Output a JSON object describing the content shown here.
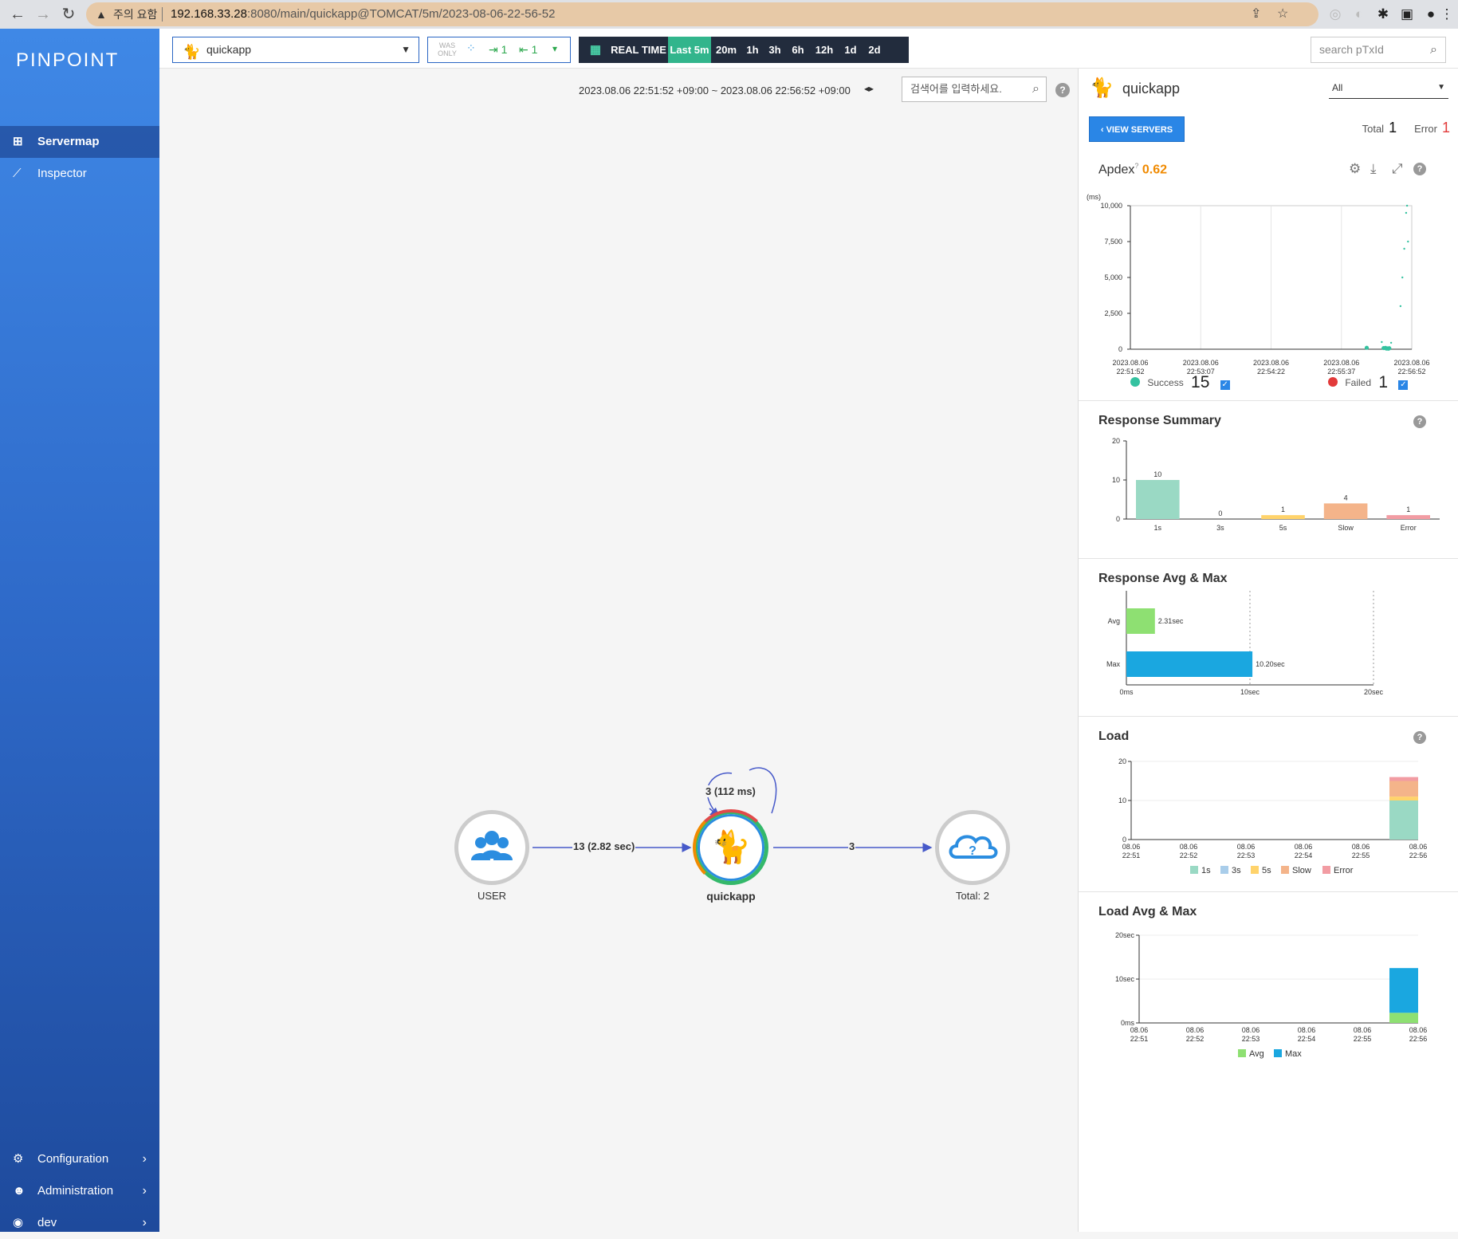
{
  "browser": {
    "warning_text": "주의 요함",
    "url_host": "192.168.33.28",
    "url_rest": ":8080/main/quickapp@TOMCAT/5m/2023-08-06-22-56-52"
  },
  "sidebar": {
    "logo": "PINPOINT",
    "items": [
      {
        "label": "Servermap",
        "icon": "servermap-icon"
      },
      {
        "label": "Inspector",
        "icon": "chart-icon"
      }
    ],
    "bottom_items": [
      {
        "label": "Configuration",
        "icon": "gear-icon"
      },
      {
        "label": "Administration",
        "icon": "user-cog-icon"
      },
      {
        "label": "dev",
        "icon": "user-circle-icon"
      }
    ]
  },
  "topbar": {
    "application": "quickapp",
    "was_only": "WAS ONLY",
    "inbound_count": "1",
    "outbound_count": "1",
    "real_time": "REAL TIME",
    "periods": [
      "Last 5m",
      "20m",
      "1h",
      "3h",
      "6h",
      "12h",
      "1d",
      "2d"
    ],
    "active_period": "Last 5m",
    "search_placeholder": "search pTxId"
  },
  "servermap": {
    "time_range": "2023.08.06 22:51:52 +09:00 ~ 2023.08.06 22:56:52 +09:00",
    "search_placeholder": "검색어를 입력하세요.",
    "nodes": {
      "user": "USER",
      "app": "quickapp",
      "unknown": "Total: 2"
    },
    "edges": {
      "user_to_app": "13 (2.82 sec)",
      "app_self": "3 (112 ms)",
      "app_to_unknown": "3"
    }
  },
  "panel": {
    "app_name": "quickapp",
    "agent_filter": "All",
    "view_servers": "VIEW SERVERS",
    "total_label": "Total",
    "total_value": "1",
    "error_label": "Error",
    "error_value": "1",
    "apdex_label": "Apdex",
    "apdex_score": "0.62",
    "success_label": "Success",
    "success_count": "15",
    "failed_label": "Failed",
    "failed_count": "1",
    "colors": {
      "success": "#34c2a0",
      "failed": "#e23a3a",
      "accent": "#2a86e6",
      "apdex": "#f08a00"
    }
  },
  "chart_data": [
    {
      "type": "scatter",
      "title": "Apdex",
      "ylabel": "(ms)",
      "ylim": [
        0,
        10000
      ],
      "yticks": [
        "10,000",
        "7,500",
        "5,000",
        "2,500",
        "0"
      ],
      "xticks": [
        "2023.08.06 22:51:52",
        "2023.08.06 22:53:07",
        "2023.08.06 22:54:22",
        "2023.08.06 22:55:37",
        "2023.08.06 22:56:52"
      ],
      "series": [
        {
          "name": "Success",
          "points": [
            [
              "22:56:04",
              100
            ],
            [
              "22:56:20",
              500
            ],
            [
              "22:56:22",
              80
            ],
            [
              "22:56:24",
              90
            ],
            [
              "22:56:26",
              60
            ],
            [
              "22:56:30",
              450
            ],
            [
              "22:56:40",
              3000
            ],
            [
              "22:56:42",
              5000
            ],
            [
              "22:56:44",
              7000
            ],
            [
              "22:56:46",
              9500
            ],
            [
              "22:56:47",
              10000
            ],
            [
              "22:56:48",
              7500
            ],
            [
              "22:56:28",
              70
            ],
            [
              "22:56:25",
              50
            ],
            [
              "22:56:27",
              40
            ]
          ]
        },
        {
          "name": "Failed",
          "points": []
        }
      ]
    },
    {
      "type": "bar",
      "title": "Response Summary",
      "categories": [
        "1s",
        "3s",
        "5s",
        "Slow",
        "Error"
      ],
      "values": [
        10,
        0,
        1,
        4,
        1
      ],
      "ylim": [
        0,
        20
      ],
      "yticks": [
        "20",
        "10",
        "0"
      ],
      "colors": [
        "#9ad9c4",
        "#a9cdea",
        "#ffd36b",
        "#f4b48a",
        "#f29ca3"
      ]
    },
    {
      "type": "bar",
      "title": "Response Avg & Max",
      "categories": [
        "Avg",
        "Max"
      ],
      "values": [
        2.31,
        10.2
      ],
      "labels": [
        "2.31sec",
        "10.20sec"
      ],
      "xlim": [
        0,
        20
      ],
      "xticks": [
        "0ms",
        "10sec",
        "20sec"
      ],
      "colors": [
        "#8ee072",
        "#1aa7e0"
      ]
    },
    {
      "type": "bar",
      "title": "Load",
      "categories": [
        "08.06 22:51",
        "08.06 22:52",
        "08.06 22:53",
        "08.06 22:54",
        "08.06 22:55",
        "08.06 22:56"
      ],
      "ylim": [
        0,
        20
      ],
      "yticks": [
        "20",
        "10",
        "0"
      ],
      "series": [
        {
          "name": "1s",
          "values": [
            0,
            0,
            0,
            0,
            0,
            10
          ]
        },
        {
          "name": "3s",
          "values": [
            0,
            0,
            0,
            0,
            0,
            0
          ]
        },
        {
          "name": "5s",
          "values": [
            0,
            0,
            0,
            0,
            0,
            1
          ]
        },
        {
          "name": "Slow",
          "values": [
            0,
            0,
            0,
            0,
            0,
            4
          ]
        },
        {
          "name": "Error",
          "values": [
            0,
            0,
            0,
            0,
            0,
            1
          ]
        }
      ],
      "colors": [
        "#9ad9c4",
        "#a9cdea",
        "#ffd36b",
        "#f4b48a",
        "#f29ca3"
      ]
    },
    {
      "type": "bar",
      "title": "Load Avg & Max",
      "categories": [
        "08.06 22:51",
        "08.06 22:52",
        "08.06 22:53",
        "08.06 22:54",
        "08.06 22:55",
        "08.06 22:56"
      ],
      "ylim": [
        0,
        20
      ],
      "yticks": [
        "20sec",
        "10sec",
        "0ms"
      ],
      "series": [
        {
          "name": "Avg",
          "values": [
            0,
            0,
            0,
            0,
            0,
            2.31
          ]
        },
        {
          "name": "Max",
          "values": [
            0,
            0,
            0,
            0,
            0,
            10.2
          ]
        }
      ],
      "colors": [
        "#8ee072",
        "#1aa7e0"
      ]
    }
  ]
}
